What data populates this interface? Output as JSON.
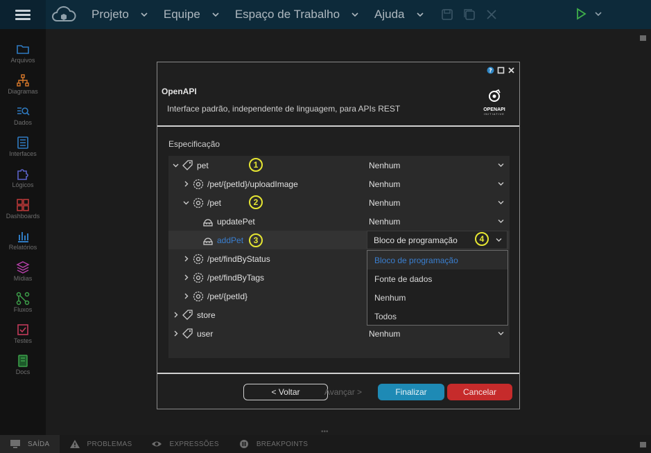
{
  "topbar": {
    "menus": [
      "Projeto",
      "Equipe",
      "Espaço de Trabalho",
      "Ajuda"
    ],
    "icons": [
      "menu-icon",
      "cloud-logo-icon",
      "save-icon",
      "save-all-icon",
      "close-icon",
      "run-icon",
      "chevron-down-icon"
    ]
  },
  "sidebar": {
    "items": [
      {
        "label": "Arquivos",
        "icon": "folder-icon",
        "color": "#2f7bc2"
      },
      {
        "label": "Diagramas",
        "icon": "diagram-icon",
        "color": "#d97a2b"
      },
      {
        "label": "Dados",
        "icon": "data-search-icon",
        "color": "#2f7bc2"
      },
      {
        "label": "Interfaces",
        "icon": "interface-icon",
        "color": "#2f7bc2"
      },
      {
        "label": "Lógicos",
        "icon": "puzzle-icon",
        "color": "#5b63c9"
      },
      {
        "label": "Dashboards",
        "icon": "dashboard-icon",
        "color": "#c23a3a"
      },
      {
        "label": "Relatórios",
        "icon": "report-icon",
        "color": "#2f7bc2"
      },
      {
        "label": "Mídias",
        "icon": "layers-icon",
        "color": "#b33fa6"
      },
      {
        "label": "Fluxos",
        "icon": "flow-icon",
        "color": "#3da04a"
      },
      {
        "label": "Testes",
        "icon": "test-icon",
        "color": "#c23a5a"
      },
      {
        "label": "Docs",
        "icon": "docs-icon",
        "color": "#3da04a"
      }
    ]
  },
  "dialog": {
    "title": "OpenAPI",
    "subtitle": "Interface padrão, independente de linguagem, para APIs REST",
    "logo_text": "OPENAPI",
    "logo_sub": "INITIATIVE",
    "section_label": "Especificação",
    "rows": [
      {
        "name": "pet",
        "value": "Nenhum",
        "marker": "1"
      },
      {
        "name": "/pet/{petId}/uploadImage",
        "value": "Nenhum"
      },
      {
        "name": "/pet",
        "value": "Nenhum",
        "marker": "2"
      },
      {
        "name": "updatePet",
        "value": "Nenhum"
      },
      {
        "name": "addPet",
        "value": "Bloco de programação",
        "marker": "3",
        "marker2": "4"
      },
      {
        "name": "/pet/findByStatus",
        "value": ""
      },
      {
        "name": "/pet/findByTags",
        "value": ""
      },
      {
        "name": "/pet/{petId}",
        "value": ""
      },
      {
        "name": "store",
        "value": ""
      },
      {
        "name": "user",
        "value": "Nenhum"
      }
    ],
    "dropdown_options": [
      "Bloco de programação",
      "Fonte de dados",
      "Nenhum",
      "Todos"
    ],
    "buttons": {
      "back": "< Voltar",
      "next": "Avançar >",
      "finish": "Finalizar",
      "cancel": "Cancelar"
    }
  },
  "bottombar": {
    "tabs": [
      "SAÍDA",
      "PROBLEMAS",
      "EXPRESSÕES",
      "BREAKPOINTS"
    ]
  },
  "colors": {
    "accent": "#1e8ab5",
    "cancel": "#c62b2b",
    "link": "#3a7fd0",
    "marker": "#e6e632"
  }
}
